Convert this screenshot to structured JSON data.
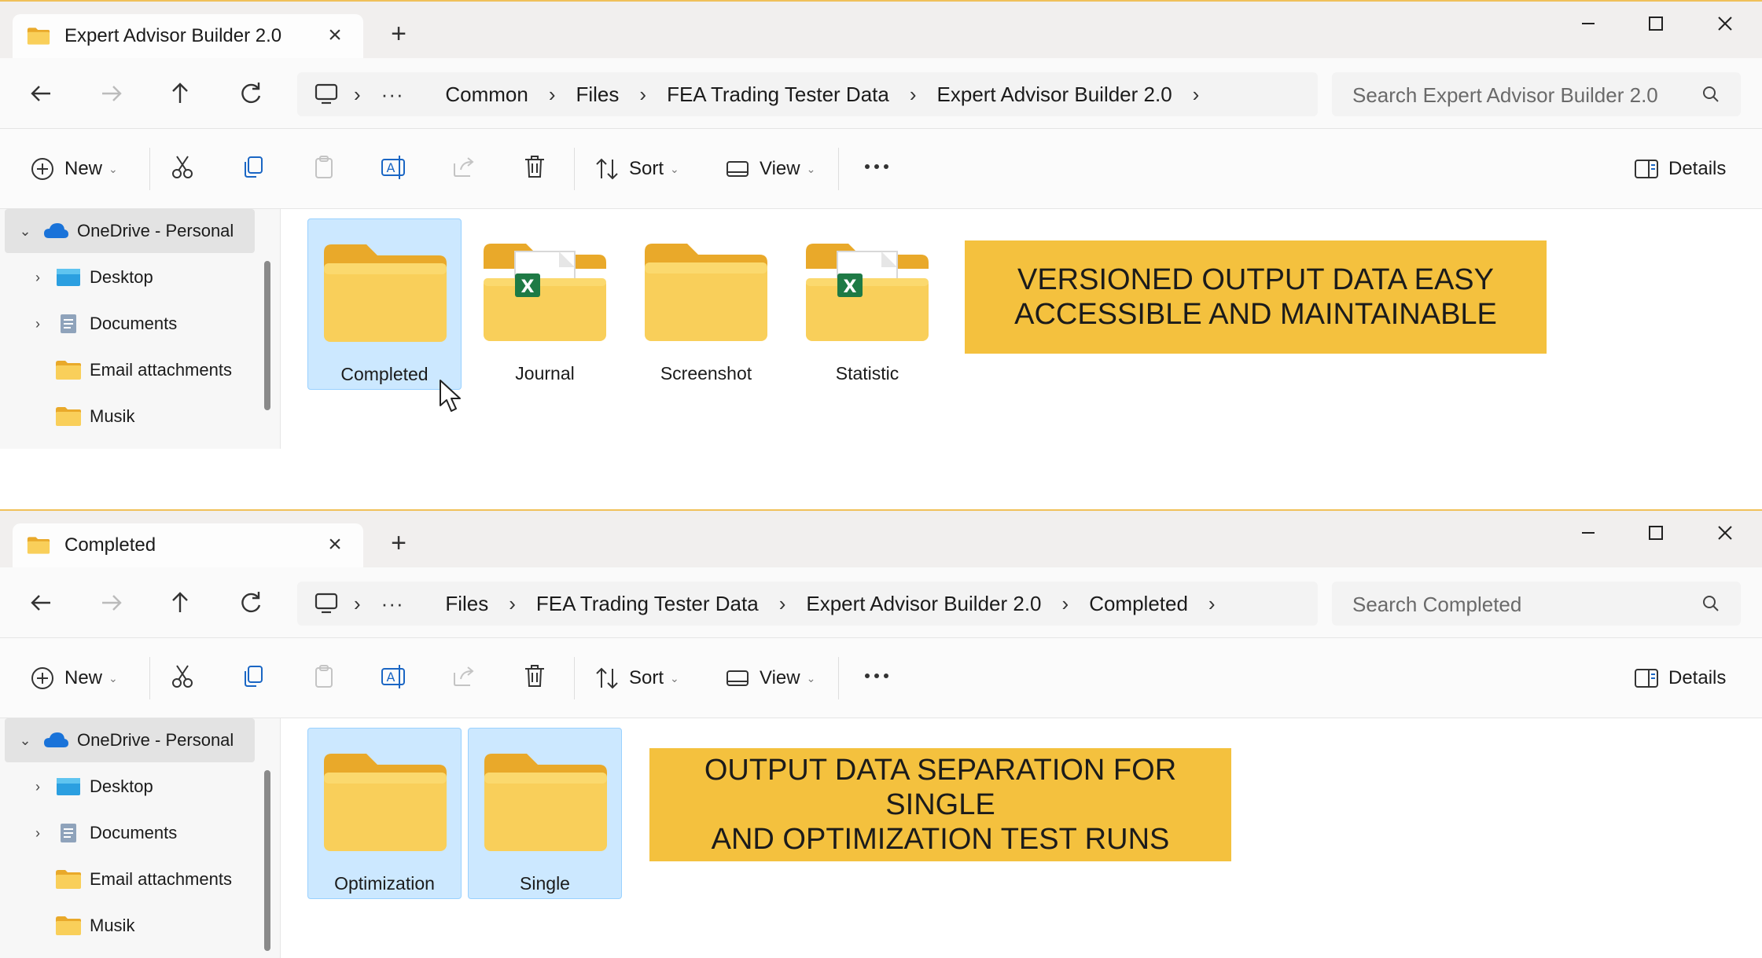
{
  "colors": {
    "accent_banner": "#f4c13e",
    "selection": "#cce8ff",
    "folder": "#f7c948",
    "window_border": "#f0c15a"
  },
  "window1": {
    "tab_title": "Expert Advisor Builder 2.0",
    "breadcrumb": [
      "Common",
      "Files",
      "FEA Trading Tester Data",
      "Expert Advisor Builder 2.0"
    ],
    "search_placeholder": "Search Expert Advisor Builder 2.0",
    "toolbar": {
      "new_label": "New",
      "sort_label": "Sort",
      "view_label": "View",
      "details_label": "Details"
    },
    "sidebar": [
      {
        "label": "OneDrive - Personal",
        "icon": "cloud-icon"
      },
      {
        "label": "Desktop",
        "icon": "desktop-icon"
      },
      {
        "label": "Documents",
        "icon": "documents-icon"
      },
      {
        "label": "Email attachments",
        "icon": "folder-icon"
      },
      {
        "label": "Musik",
        "icon": "folder-icon"
      }
    ],
    "items": [
      {
        "label": "Completed",
        "icon": "folder-icon",
        "selected": true
      },
      {
        "label": "Journal",
        "icon": "excel-folder-icon",
        "selected": false
      },
      {
        "label": "Screenshot",
        "icon": "folder-icon",
        "selected": false
      },
      {
        "label": "Statistic",
        "icon": "excel-folder-icon",
        "selected": false
      }
    ],
    "banner": {
      "line1": "VERSIONED OUTPUT DATA EASY",
      "line2": "ACCESSIBLE AND MAINTAINABLE"
    }
  },
  "window2": {
    "tab_title": "Completed",
    "breadcrumb": [
      "Files",
      "FEA Trading Tester Data",
      "Expert Advisor Builder 2.0",
      "Completed"
    ],
    "search_placeholder": "Search Completed",
    "toolbar": {
      "new_label": "New",
      "sort_label": "Sort",
      "view_label": "View",
      "details_label": "Details"
    },
    "sidebar": [
      {
        "label": "OneDrive - Personal",
        "icon": "cloud-icon"
      },
      {
        "label": "Desktop",
        "icon": "desktop-icon"
      },
      {
        "label": "Documents",
        "icon": "documents-icon"
      },
      {
        "label": "Email attachments",
        "icon": "folder-icon"
      },
      {
        "label": "Musik",
        "icon": "folder-icon"
      }
    ],
    "items": [
      {
        "label": "Optimization",
        "icon": "folder-icon",
        "selected": true
      },
      {
        "label": "Single",
        "icon": "folder-icon",
        "selected": true
      }
    ],
    "banner": {
      "line1": "OUTPUT DATA SEPARATION FOR SINGLE",
      "line2": "AND OPTIMIZATION TEST RUNS"
    }
  }
}
